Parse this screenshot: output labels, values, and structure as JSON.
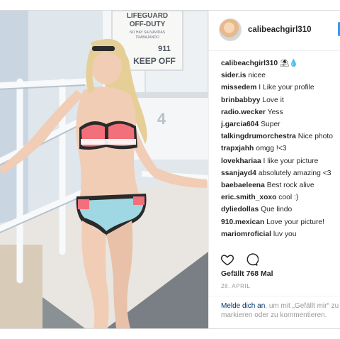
{
  "photo": {
    "sign": {
      "line1": "LIFEGUARD",
      "line2": "OFF-DUTY",
      "line3": "NO HAY SALVAVIDAS",
      "line4": "TRABAJANDO",
      "number": "911",
      "line5": "KEEP OFF"
    },
    "tower_number": "4",
    "colors": {
      "sky": "#c9d6e2",
      "tower": "#f4f6f8",
      "sand": "#d8cbb8",
      "bikini_pink": "#f2707a",
      "bikini_blue": "#9fd8e3",
      "skin": "#f1cdb6",
      "hair": "#e6cf97"
    }
  },
  "post": {
    "author": "calibeachgirl310",
    "caption": {
      "user": "calibeachgirl310",
      "emoji": "⛱💧"
    },
    "comments": [
      {
        "user": "sider.is",
        "text": "nicee"
      },
      {
        "user": "missedem",
        "text": "I Like your profile"
      },
      {
        "user": "brinbabbyy",
        "text": "Love it"
      },
      {
        "user": "radio.wecker",
        "text": "Yess"
      },
      {
        "user": "j.garcia604",
        "text": "Super"
      },
      {
        "user": "talkingdrumorchestra",
        "text": "Nice photo"
      },
      {
        "user": "trapxjahh",
        "text": "omgg !<3"
      },
      {
        "user": "lovekhariaa",
        "text": "I like your picture"
      },
      {
        "user": "ssanjayd4",
        "text": "absolutely amazing <3"
      },
      {
        "user": "baebaeleena",
        "text": "Best rock alive"
      },
      {
        "user": "eric.smith_xoxo",
        "text": "cool :)"
      },
      {
        "user": "dyliedollas",
        "text": "Que lindo"
      },
      {
        "user": "910.mexican",
        "text": "Love your picture!"
      },
      {
        "user": "mariomroficial",
        "text": "luv you"
      }
    ],
    "likes": "Gefällt 768 Mal",
    "date": "28. APRIL",
    "login_link": "Melde dich an",
    "login_text": ", um mit „Gefällt mir“ zu markieren oder zu kommentieren.",
    "icons": {
      "like": "heart-icon",
      "comment": "comment-bubble-icon"
    },
    "accent": "#3897f0"
  }
}
